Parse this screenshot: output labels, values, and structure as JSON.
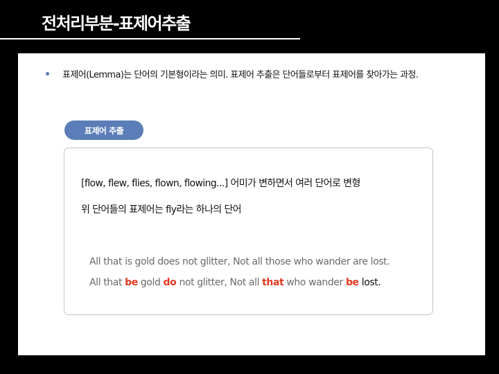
{
  "slide": {
    "title": "전처리부분-표제어추출"
  },
  "content": {
    "bullet_text": "표제어(Lemma)는 단어의 기본형이라는 의미. 표제어 추출은 단어들로부터 표제어를 찾아가는 과정.",
    "section_label": "표제어 추출",
    "example_line_1": "[flow, flew, flies, flown, flowing...] 어미가 변하면서 여러 단어로 변형",
    "example_line_2": "위 단어들의 표제어는 fly라는 하나의 단어",
    "quote_original": "All that is gold does not glitter, Not all those who wander are lost.",
    "quote_lemma": {
      "p1": "All that ",
      "w1": "be",
      "p2": " gold ",
      "w2": "do",
      "p3": " not glitter, Not all ",
      "w3": "that",
      "p4": " who wander ",
      "w4": "be",
      "p5": " lost."
    }
  },
  "colors": {
    "background": "#000000",
    "accent": "#5b7db8",
    "highlight": "#e23a22"
  }
}
